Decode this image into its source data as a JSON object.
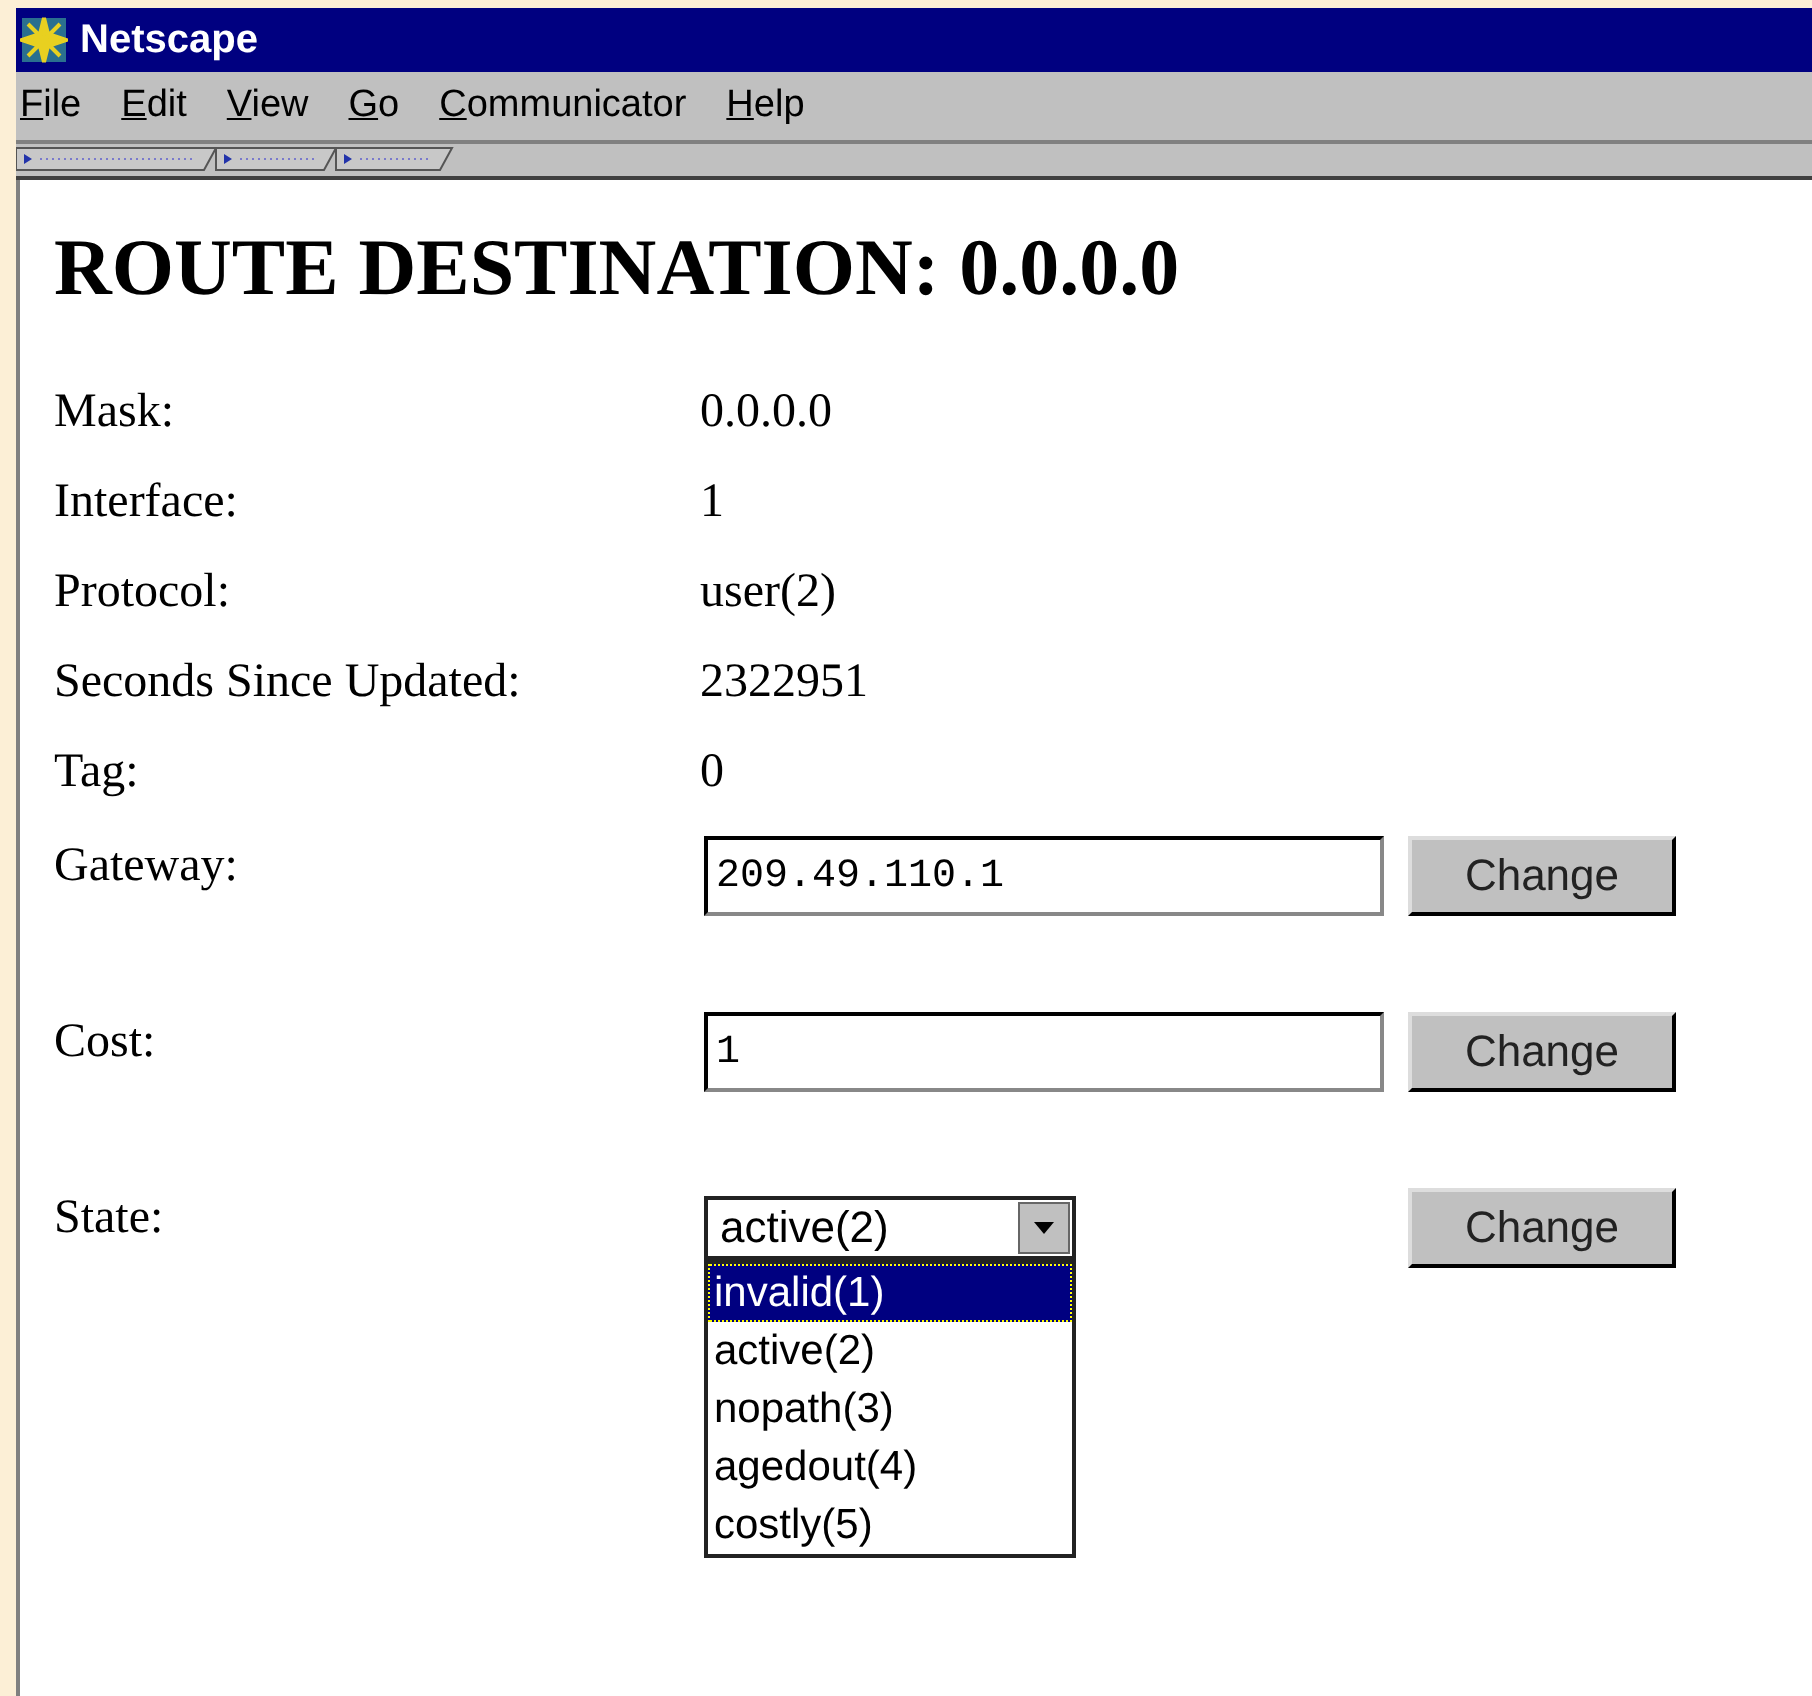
{
  "window": {
    "title": "Netscape"
  },
  "menu": [
    {
      "label": "File"
    },
    {
      "label": "Edit"
    },
    {
      "label": "View"
    },
    {
      "label": "Go"
    },
    {
      "label": "Communicator"
    },
    {
      "label": "Help"
    }
  ],
  "heading": "ROUTE DESTINATION: 0.0.0.0",
  "fields": [
    {
      "kind": "text",
      "label": "Mask:",
      "value": "0.0.0.0"
    },
    {
      "kind": "text",
      "label": "Interface:",
      "value": "1"
    },
    {
      "kind": "text",
      "label": "Protocol:",
      "value": "user(2)"
    },
    {
      "kind": "text",
      "label": "Seconds Since Updated:",
      "value": "2322951"
    },
    {
      "kind": "text",
      "label": "Tag:",
      "value": "0"
    },
    {
      "kind": "input",
      "label": "Gateway:",
      "value": "209.49.110.1",
      "button": "Change"
    },
    {
      "kind": "input",
      "label": "Cost:",
      "value": "1",
      "button": "Change"
    },
    {
      "kind": "select",
      "label": "State:",
      "value": "active(2)",
      "button": "Change",
      "expanded": true,
      "options": [
        {
          "label": "invalid(1)",
          "highlighted": true
        },
        {
          "label": "active(2)",
          "highlighted": false
        },
        {
          "label": "nopath(3)",
          "highlighted": false
        },
        {
          "label": "agedout(4)",
          "highlighted": false
        },
        {
          "label": "costly(5)",
          "highlighted": false
        }
      ]
    }
  ]
}
